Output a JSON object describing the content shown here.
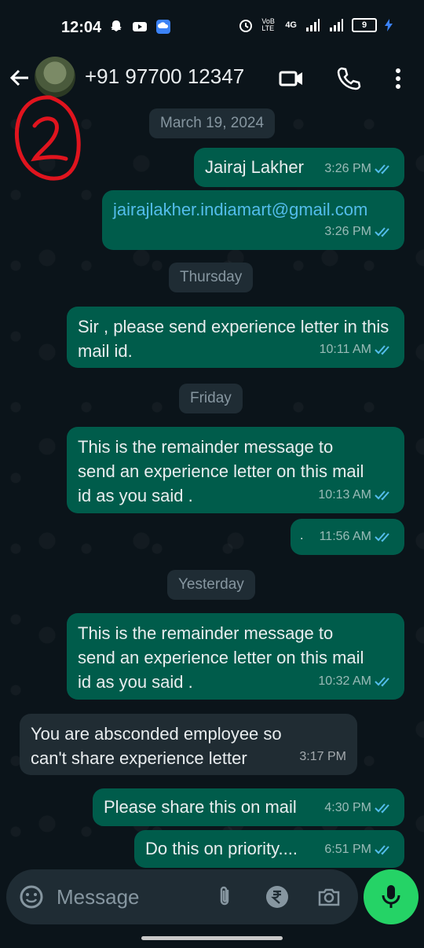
{
  "status_bar": {
    "time": "12:04",
    "network": "4G",
    "volte": "VoB LTE",
    "battery": "9"
  },
  "header": {
    "contact_name": "+91 97700 12347",
    "icons": [
      "back-arrow-icon",
      "avatar",
      "video-call-icon",
      "phone-icon",
      "more-vert-icon"
    ]
  },
  "messages": [
    {
      "type": "date",
      "text": "March 19, 2024"
    },
    {
      "type": "out",
      "text": "Jairaj Lakher",
      "time": "3:26 PM"
    },
    {
      "type": "out",
      "text": "jairajlakher.indiamart@gmail.com",
      "time": "3:26 PM",
      "link": true
    },
    {
      "type": "date",
      "text": "Thursday"
    },
    {
      "type": "out",
      "text": "Sir , please send experience letter in this mail id.",
      "time": "10:11 AM"
    },
    {
      "type": "date",
      "text": "Friday"
    },
    {
      "type": "out",
      "text": "This is the remainder message to send an experience letter on this mail id as you said .",
      "time": "10:13 AM"
    },
    {
      "type": "out",
      "text": ".",
      "time": "11:56 AM"
    },
    {
      "type": "date",
      "text": "Yesterday"
    },
    {
      "type": "out",
      "text": "This is the remainder message to send an experience letter on this mail id as you said .",
      "time": "10:32 AM"
    },
    {
      "type": "in",
      "text": "You are absconded employee so can't share experience letter",
      "time": "3:17 PM"
    },
    {
      "type": "out",
      "text": "Please share this on mail",
      "time": "4:30 PM"
    },
    {
      "type": "out",
      "text": "Do this on priority....",
      "time": "6:51 PM"
    }
  ],
  "composer": {
    "placeholder": "Message"
  },
  "colors": {
    "background": "#0b141a",
    "outgoing_bubble": "#005c4b",
    "incoming_bubble": "#202c33",
    "read_ticks": "#53bdeb",
    "mic_button": "#25d366"
  }
}
